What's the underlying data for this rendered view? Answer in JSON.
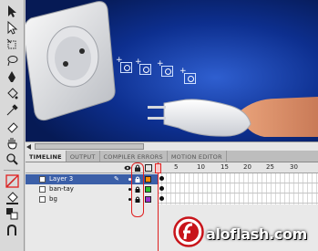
{
  "panel_tabs": [
    "TIMELINE",
    "OUTPUT",
    "COMPILER ERRORS",
    "MOTION EDITOR"
  ],
  "active_tab": "TIMELINE",
  "frame_numbers": [
    "5",
    "10",
    "15",
    "20",
    "25",
    "30"
  ],
  "layers": [
    {
      "name": "Layer 3",
      "selected": true,
      "color": "#ff8a00"
    },
    {
      "name": "ban-tay",
      "selected": false,
      "color": "#2fbf2f"
    },
    {
      "name": "bg",
      "selected": false,
      "color": "#9a33cc"
    }
  ],
  "colors": {
    "stage": "#0b2a7a",
    "highlight": "#e02020",
    "selection": "#3b5fa8"
  },
  "watermark": "aloflash.com",
  "icons": [
    "selection-tool-icon",
    "subselection-tool-icon",
    "free-transform-tool-icon",
    "lasso-tool-icon",
    "pen-tool-icon",
    "text-tool-icon",
    "line-tool-icon",
    "rectangle-tool-icon",
    "pencil-tool-icon",
    "brush-tool-icon",
    "paint-bucket-tool-icon",
    "eyedropper-tool-icon",
    "eraser-tool-icon",
    "hand-tool-icon",
    "zoom-tool-icon",
    "stroke-color-icon",
    "fill-color-icon",
    "swap-colors-icon"
  ]
}
